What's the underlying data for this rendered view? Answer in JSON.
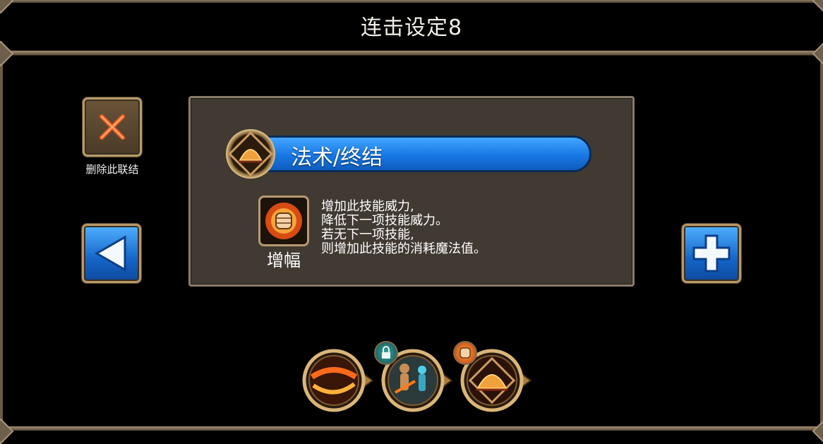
{
  "header": {
    "title": "连击设定8"
  },
  "delete_link": {
    "label": "删除此联结",
    "icon": "close-icon"
  },
  "nav": {
    "prev_icon": "left-arrow-icon",
    "add_icon": "plus-icon"
  },
  "skill": {
    "name": "法术/终结",
    "icon": "dome-skill-icon"
  },
  "buff": {
    "name": "增幅",
    "icon": "flaming-fist-icon",
    "description": [
      "增加此技能威力,",
      "降低下一项技能威力。",
      "若无下一项技能,",
      "则增加此技能的消耗魔法值。"
    ]
  },
  "chain": [
    {
      "icon": "fire-swirl-skill-icon",
      "badge": null
    },
    {
      "icon": "figures-skill-icon",
      "badge": "lock-icon"
    },
    {
      "icon": "dome-skill-icon",
      "badge": "flaming-fist-icon"
    }
  ],
  "colors": {
    "accent_blue": "#1778e4",
    "frame_gold": "#b69a68",
    "panel_bg": "#413a32"
  }
}
